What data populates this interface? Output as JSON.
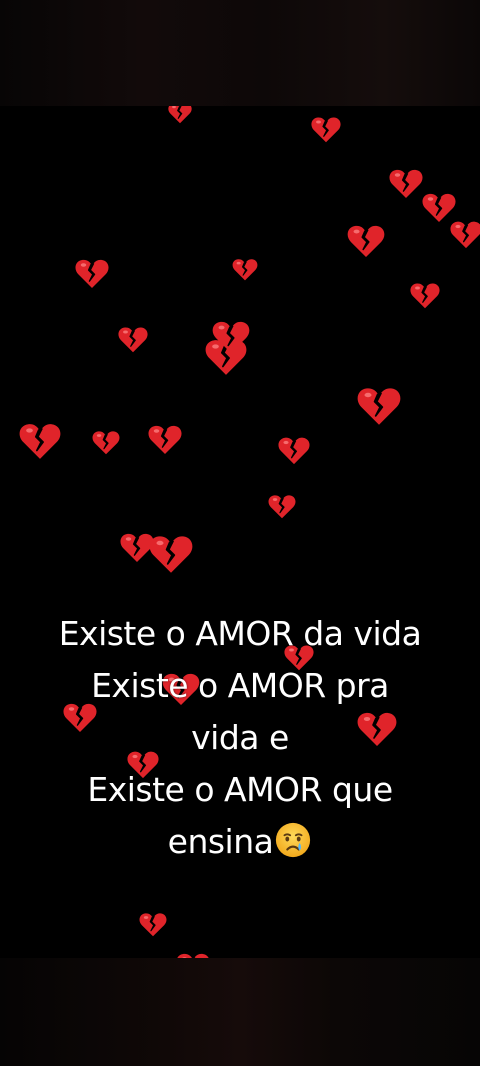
{
  "caption": {
    "lines": [
      "Existe o AMOR da vida",
      "Existe o AMOR pra",
      "vida e",
      "Existe o AMOR que",
      "ensina"
    ],
    "trailing_emoji": "crying-face-icon"
  },
  "decorations": {
    "heart_icon": "broken-heart-icon",
    "heart_color": "#e0242a",
    "background_color": "#000000"
  }
}
